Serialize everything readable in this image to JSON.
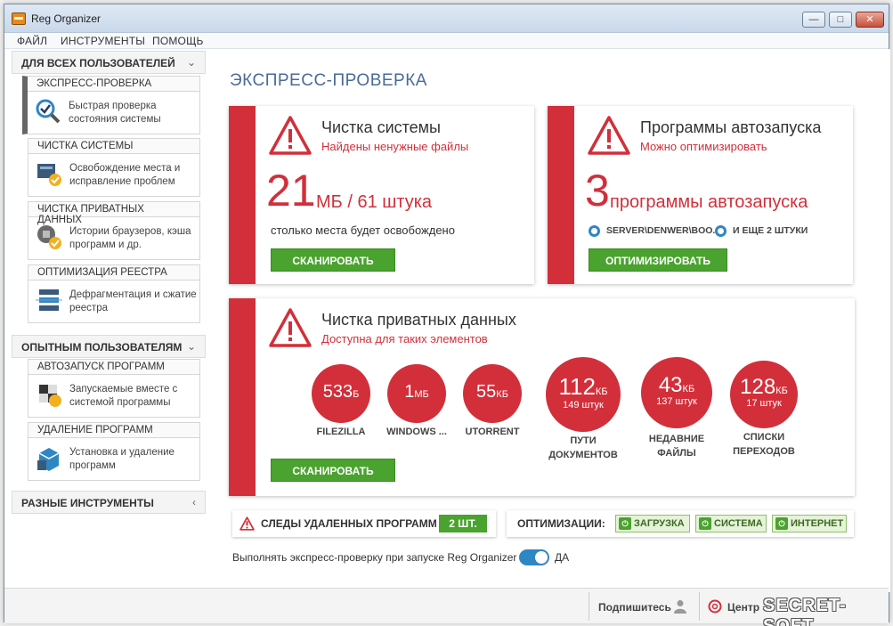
{
  "window": {
    "title": "Reg Organizer"
  },
  "menu": [
    "ФАЙЛ",
    "ИНСТРУМЕНТЫ",
    "ПОМОЩЬ"
  ],
  "sidebar": {
    "section_all": "ДЛЯ ВСЕХ ПОЛЬЗОВАТЕЛЕЙ",
    "section_exp": "ОПЫТНЫМ ПОЛЬЗОВАТЕЛЯМ",
    "section_misc": "РАЗНЫЕ ИНСТРУМЕНТЫ",
    "items": [
      {
        "title": "ЭКСПРЕСС-ПРОВЕРКА",
        "desc": "Быстрая проверка состояния системы",
        "icon": "magnifier-check-icon"
      },
      {
        "title": "ЧИСТКА СИСТЕМЫ",
        "desc": "Освобождение места и исправление проблем",
        "icon": "disk-clean-icon"
      },
      {
        "title": "ЧИСТКА ПРИВАТНЫХ ДАННЫХ",
        "desc": "Истории браузеров, кэша программ и др.",
        "icon": "private-clean-icon"
      },
      {
        "title": "ОПТИМИЗАЦИЯ РЕЕСТРА",
        "desc": "Дефрагментация и сжатие реестра",
        "icon": "registry-icon"
      },
      {
        "title": "АВТОЗАПУСК ПРОГРАММ",
        "desc": "Запускаемые вместе с системой программы",
        "icon": "autorun-icon"
      },
      {
        "title": "УДАЛЕНИЕ ПРОГРАММ",
        "desc": "Установка и удаление программ",
        "icon": "uninstall-icon"
      }
    ]
  },
  "main": {
    "title": "ЭКСПРЕСС-ПРОВЕРКА",
    "clean": {
      "title": "Чистка системы",
      "sub": "Найдены ненужные файлы",
      "num": "21",
      "unit": "МБ / 61 штука",
      "desc": "столько места будет освобождено",
      "button": "СКАНИРОВАТЬ"
    },
    "autorun": {
      "title": "Программы автозапуска",
      "sub": "Можно оптимизировать",
      "num": "3",
      "unit": "программы автозапуска",
      "chip1": "SERVER\\DENWER\\BOO...",
      "chip2": "И ЕЩЕ 2 ШТУКИ",
      "button": "ОПТИМИЗИРОВАТЬ"
    },
    "private": {
      "title": "Чистка приватных данных",
      "sub": "Доступна для таких элементов",
      "button": "СКАНИРОВАТЬ",
      "items": [
        {
          "value": "533",
          "unit": "Б",
          "sub": "",
          "label": "FILEZILLA"
        },
        {
          "value": "1",
          "unit": "МБ",
          "sub": "",
          "label": "WINDOWS ..."
        },
        {
          "value": "55",
          "unit": "КБ",
          "sub": "",
          "label": "UTORRENT"
        },
        {
          "value": "112",
          "unit": "КБ",
          "sub": "149 штук",
          "label": "ПУТИ ДОКУМЕНТОВ"
        },
        {
          "value": "43",
          "unit": "КБ",
          "sub": "137 штук",
          "label": "НЕДАВНИЕ ФАЙЛЫ"
        },
        {
          "value": "128",
          "unit": "КБ",
          "sub": "17 штук",
          "label": "СПИСКИ ПЕРЕХОДОВ"
        }
      ]
    },
    "traces": {
      "label": "СЛЕДЫ УДАЛЕННЫХ ПРОГРАММ",
      "count": "2 ШТ."
    },
    "optim": {
      "label": "ОПТИМИЗАЦИИ:",
      "buttons": [
        "ЗАГРУЗКА",
        "СИСТЕМА",
        "ИНТЕРНЕТ"
      ]
    },
    "autocheck": {
      "label": "Выполнять экспресс-проверку при запуске Reg Organizer",
      "value": "ДА"
    }
  },
  "status": {
    "subscribe": "Подпишитесь",
    "center": "Центр",
    "watermark": "SECRET-SOFT"
  },
  "colors": {
    "accent": "#d22f3a",
    "green": "#4aa32e",
    "blue": "#2f86c5"
  }
}
